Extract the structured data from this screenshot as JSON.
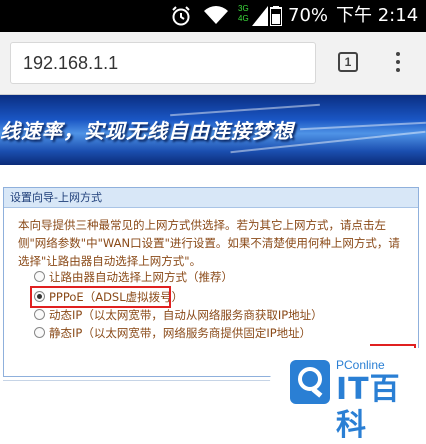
{
  "status_bar": {
    "alarm_icon": "alarm-clock",
    "wifi_icon": "wifi",
    "signal_icon": "signal-3g-4g",
    "signal_top": "3G",
    "signal_bottom": "4G",
    "battery_icon": "battery",
    "battery": "70%",
    "time": "下午 2:14"
  },
  "browser": {
    "url": "192.168.1.1",
    "tab_count": "1",
    "menu_icon": "more-vertical"
  },
  "banner": {
    "slogan": "线速率，实现无线自由连接梦想"
  },
  "panel": {
    "title": "设置向导-上网方式",
    "intro": "本向导提供三种最常见的上网方式供选择。若为其它上网方式，请点击左侧\"网络参数\"中\"WAN口设置\"进行设置。如果不清楚使用何种上网方式，请选择\"让路由器自动选择上网方式\"。",
    "options": [
      {
        "label": "让路由器自动选择上网方式（推荐）",
        "selected": false
      },
      {
        "label": "PPPoE（ADSL虚拟拨号）",
        "selected": true
      },
      {
        "label": "动态IP（以太网宽带，自动从网络服务商获取IP地址）",
        "selected": false
      },
      {
        "label": "静态IP（以太网宽带，网络服务商提供固定IP地址）",
        "selected": false
      }
    ]
  },
  "watermark": {
    "brand": "PConline",
    "name": "IT百科"
  },
  "colors": {
    "highlight": "#e02020",
    "panel_header_bg": "#d8e7f7",
    "option_text": "#8a4a18",
    "watermark": "#2a7fd4"
  }
}
